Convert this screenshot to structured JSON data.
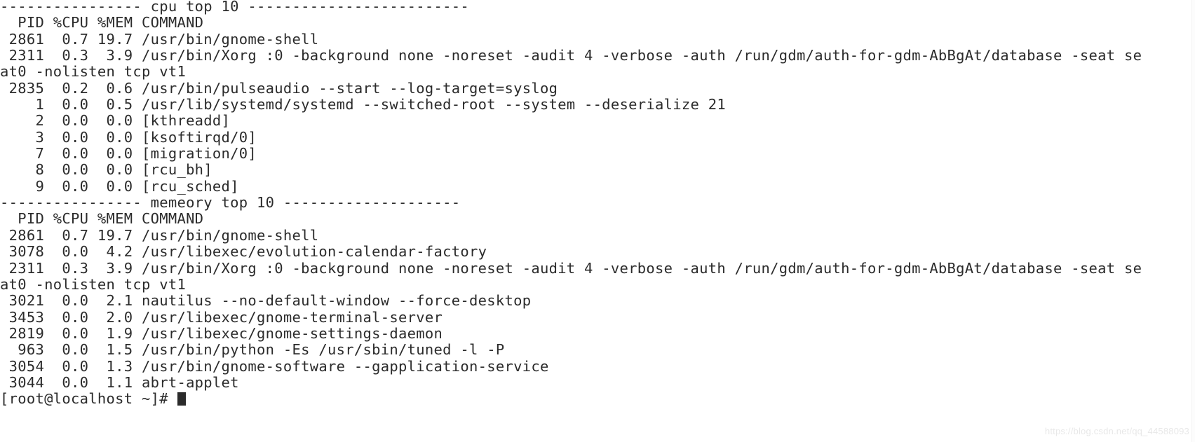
{
  "terminal": {
    "prompt": "[root@localhost ~]# ",
    "cursor": "block-cursor",
    "watermark": "https://blog.csdn.net/qq_44588093",
    "foreground_color": "#2b2b2b",
    "background_color": "#ffffff",
    "sections": [
      {
        "separator_title": "cpu top 10",
        "separator_left": "----------------",
        "separator_right": "-------------------------",
        "header": "  PID %CPU %MEM COMMAND"
      },
      {
        "separator_title": "memeory top 10",
        "separator_left": "----------------",
        "separator_right": "--------------------",
        "header": "  PID %CPU %MEM COMMAND"
      }
    ],
    "lines": [
      "---------------- cpu top 10 -------------------------",
      "  PID %CPU %MEM COMMAND",
      " 2861  0.7 19.7 /usr/bin/gnome-shell",
      " 2311  0.3  3.9 /usr/bin/Xorg :0 -background none -noreset -audit 4 -verbose -auth /run/gdm/auth-for-gdm-AbBgAt/database -seat se",
      "at0 -nolisten tcp vt1",
      " 2835  0.2  0.6 /usr/bin/pulseaudio --start --log-target=syslog",
      "    1  0.0  0.5 /usr/lib/systemd/systemd --switched-root --system --deserialize 21",
      "    2  0.0  0.0 [kthreadd]",
      "    3  0.0  0.0 [ksoftirqd/0]",
      "    7  0.0  0.0 [migration/0]",
      "    8  0.0  0.0 [rcu_bh]",
      "    9  0.0  0.0 [rcu_sched]",
      "---------------- memeory top 10 --------------------",
      "  PID %CPU %MEM COMMAND",
      " 2861  0.7 19.7 /usr/bin/gnome-shell",
      " 3078  0.0  4.2 /usr/libexec/evolution-calendar-factory",
      " 2311  0.3  3.9 /usr/bin/Xorg :0 -background none -noreset -audit 4 -verbose -auth /run/gdm/auth-for-gdm-AbBgAt/database -seat se",
      "at0 -nolisten tcp vt1",
      " 3021  0.0  2.1 nautilus --no-default-window --force-desktop",
      " 3453  0.0  2.0 /usr/libexec/gnome-terminal-server",
      " 2819  0.0  1.9 /usr/libexec/gnome-settings-daemon",
      "  963  0.0  1.5 /usr/bin/python -Es /usr/sbin/tuned -l -P",
      " 3054  0.0  1.3 /usr/bin/gnome-software --gapplication-service",
      " 3044  0.0  1.1 abrt-applet"
    ],
    "processes_cpu": [
      {
        "pid": "2861",
        "cpu": "0.7",
        "mem": "19.7",
        "command": "/usr/bin/gnome-shell"
      },
      {
        "pid": "2311",
        "cpu": "0.3",
        "mem": "3.9",
        "command": "/usr/bin/Xorg :0 -background none -noreset -audit 4 -verbose -auth /run/gdm/auth-for-gdm-AbBgAt/database -seat seat0 -nolisten tcp vt1"
      },
      {
        "pid": "2835",
        "cpu": "0.2",
        "mem": "0.6",
        "command": "/usr/bin/pulseaudio --start --log-target=syslog"
      },
      {
        "pid": "1",
        "cpu": "0.0",
        "mem": "0.5",
        "command": "/usr/lib/systemd/systemd --switched-root --system --deserialize 21"
      },
      {
        "pid": "2",
        "cpu": "0.0",
        "mem": "0.0",
        "command": "[kthreadd]"
      },
      {
        "pid": "3",
        "cpu": "0.0",
        "mem": "0.0",
        "command": "[ksoftirqd/0]"
      },
      {
        "pid": "7",
        "cpu": "0.0",
        "mem": "0.0",
        "command": "[migration/0]"
      },
      {
        "pid": "8",
        "cpu": "0.0",
        "mem": "0.0",
        "command": "[rcu_bh]"
      },
      {
        "pid": "9",
        "cpu": "0.0",
        "mem": "0.0",
        "command": "[rcu_sched]"
      }
    ],
    "processes_memory": [
      {
        "pid": "2861",
        "cpu": "0.7",
        "mem": "19.7",
        "command": "/usr/bin/gnome-shell"
      },
      {
        "pid": "3078",
        "cpu": "0.0",
        "mem": "4.2",
        "command": "/usr/libexec/evolution-calendar-factory"
      },
      {
        "pid": "2311",
        "cpu": "0.3",
        "mem": "3.9",
        "command": "/usr/bin/Xorg :0 -background none -noreset -audit 4 -verbose -auth /run/gdm/auth-for-gdm-AbBgAt/database -seat seat0 -nolisten tcp vt1"
      },
      {
        "pid": "3021",
        "cpu": "0.0",
        "mem": "2.1",
        "command": "nautilus --no-default-window --force-desktop"
      },
      {
        "pid": "3453",
        "cpu": "0.0",
        "mem": "2.0",
        "command": "/usr/libexec/gnome-terminal-server"
      },
      {
        "pid": "2819",
        "cpu": "0.0",
        "mem": "1.9",
        "command": "/usr/libexec/gnome-settings-daemon"
      },
      {
        "pid": "963",
        "cpu": "0.0",
        "mem": "1.5",
        "command": "/usr/bin/python -Es /usr/sbin/tuned -l -P"
      },
      {
        "pid": "3054",
        "cpu": "0.0",
        "mem": "1.3",
        "command": "/usr/bin/gnome-software --gapplication-service"
      },
      {
        "pid": "3044",
        "cpu": "0.0",
        "mem": "1.1",
        "command": "abrt-applet"
      }
    ]
  }
}
